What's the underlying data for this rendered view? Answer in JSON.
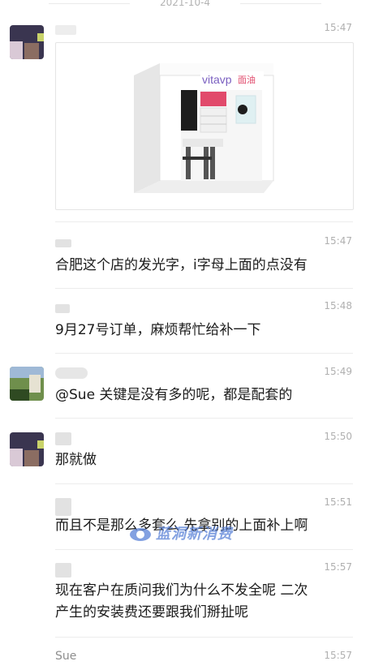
{
  "header": {
    "date": "2021-10-4"
  },
  "messages": [
    {
      "time": "15:47",
      "sender": "",
      "type": "image",
      "brand": "vitavp",
      "brand_cn": "面油"
    },
    {
      "time": "15:47",
      "sender": "",
      "text": "合肥这个店的发光字，i字母上面的点没有"
    },
    {
      "time": "15:48",
      "sender": "",
      "text": "9月27号订单，麻烦帮忙给补一下"
    },
    {
      "time": "15:49",
      "sender": "",
      "text": "@Sue 关键是没有多的呢，都是配套的"
    },
    {
      "time": "15:50",
      "sender": "",
      "text": "那就做"
    },
    {
      "time": "15:51",
      "sender": "",
      "text": "而且不是那么多套么 先拿别的上面补上啊"
    },
    {
      "time": "15:57",
      "sender": "",
      "text_line1": "现在客户在质问我们为什么不发全呢 二次",
      "text_line2": "产生的安装费还要跟我们掰扯呢"
    },
    {
      "time": "15:57",
      "sender": "Sue"
    }
  ],
  "watermark": {
    "text": "蓝洞新消费"
  },
  "colors": {
    "time": "#b0b0b0",
    "divider": "#ececec",
    "brand": "#7a5fc0",
    "accent": "#e14a6b"
  }
}
